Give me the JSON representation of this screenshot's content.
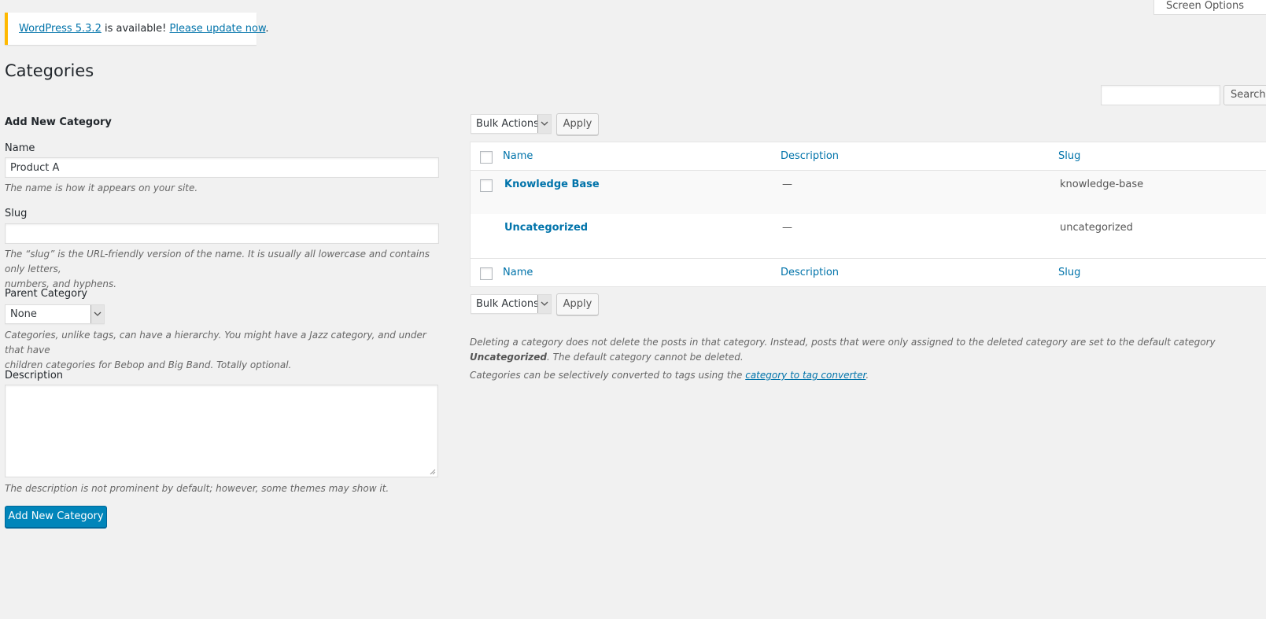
{
  "screen_options": {
    "label": "Screen Options"
  },
  "notice": {
    "version_link": "WordPress 5.3.2",
    "middle_text": " is available! ",
    "update_link": "Please update now",
    "end_text": "."
  },
  "page": {
    "title": "Categories"
  },
  "form": {
    "heading": "Add New Category",
    "name_label": "Name",
    "name_value": "Product A",
    "name_help": "The name is how it appears on your site.",
    "slug_label": "Slug",
    "slug_value": "",
    "slug_help_line1": "The “slug” is the URL-friendly version of the name. It is usually all lowercase and contains only letters,",
    "slug_help_line2": "numbers, and hyphens.",
    "parent_label": "Parent Category",
    "parent_selected": "None",
    "parent_help_line1": "Categories, unlike tags, can have a hierarchy. You might have a Jazz category, and under that have",
    "parent_help_line2": "children categories for Bebop and Big Band. Totally optional.",
    "description_label": "Description",
    "description_value": "",
    "description_help": "The description is not prominent by default; however, some themes may show it.",
    "submit_label": "Add New Category"
  },
  "search": {
    "value": "",
    "button_label": "Search Categories"
  },
  "bulk_top": {
    "selected": "Bulk Actions",
    "apply_label": "Apply"
  },
  "bulk_bottom": {
    "selected": "Bulk Actions",
    "apply_label": "Apply"
  },
  "table": {
    "columns": {
      "name": "Name",
      "description": "Description",
      "slug": "Slug"
    },
    "rows": [
      {
        "name": "Knowledge Base",
        "description": "—",
        "slug": "knowledge-base"
      },
      {
        "name": "Uncategorized",
        "description": "—",
        "slug": "uncategorized"
      }
    ]
  },
  "notes": {
    "delete_pre": "Deleting a category does not delete the posts in that category. Instead, posts that were only assigned to the deleted category are set to the default category ",
    "delete_bold": "Uncategorized",
    "delete_post": ". The default category cannot be deleted.",
    "converter_pre": "Categories can be selectively converted to tags using the ",
    "converter_link": "category to tag converter",
    "converter_post": "."
  },
  "colors": {
    "primary_button": "#0085ba",
    "link": "#0073aa",
    "notice_warning": "#ffb900",
    "background": "#f1f1f1"
  },
  "icons": {
    "select_arrow": "chevron-down-icon",
    "textarea_resize": "resize-grip-icon"
  }
}
